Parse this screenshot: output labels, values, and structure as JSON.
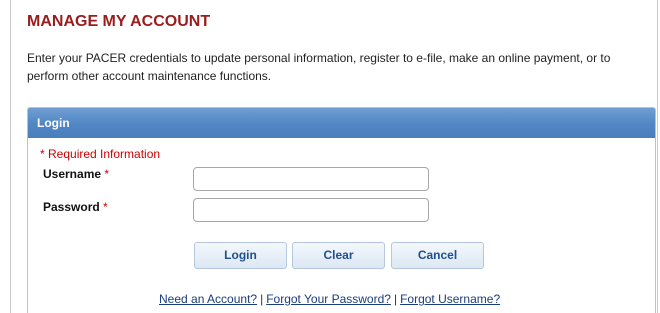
{
  "page": {
    "title": "MANAGE MY ACCOUNT",
    "intro": "Enter your PACER credentials to update personal information, register to e-file, make an online payment, or to perform other account maintenance functions."
  },
  "login_panel": {
    "header": "Login",
    "required_note": "* Required Information",
    "username_label": "Username",
    "password_label": "Password",
    "required_marker": "*",
    "username_value": "",
    "password_value": "",
    "buttons": {
      "login": "Login",
      "clear": "Clear",
      "cancel": "Cancel"
    },
    "links": {
      "need_account": "Need an Account?",
      "forgot_password": "Forgot Your Password?",
      "forgot_username": "Forgot Username?",
      "separator": "|"
    }
  },
  "colors": {
    "title": "#9b1c1c",
    "header_bar": "#5186c4",
    "required": "#cc0000",
    "link": "#1a3d7c",
    "button_text": "#1f4f8d"
  }
}
